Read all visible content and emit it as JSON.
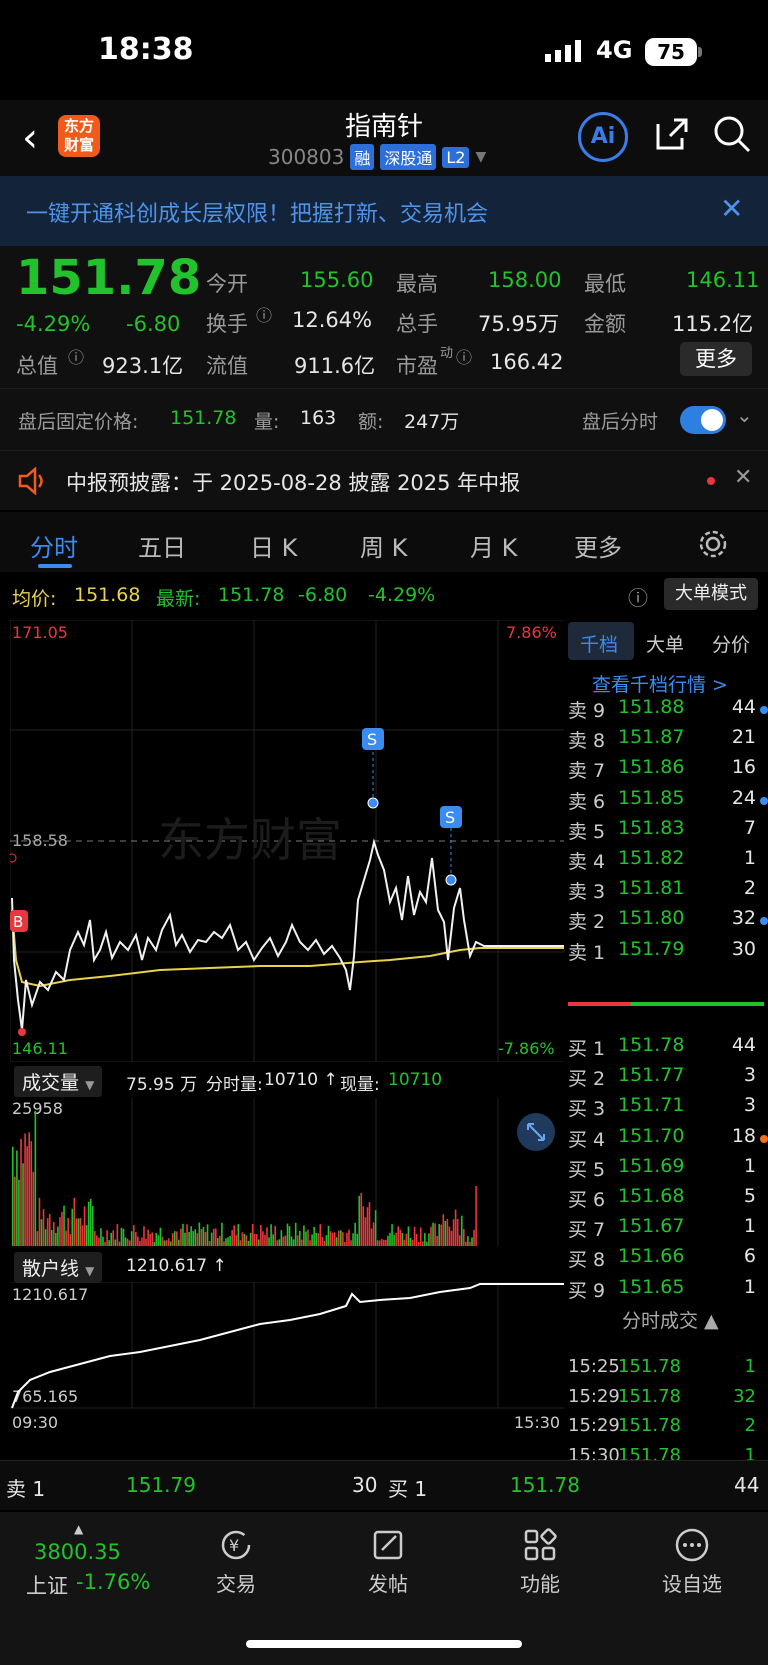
{
  "status": {
    "time": "18:38",
    "network": "4G",
    "battery": "75"
  },
  "nav": {
    "logo": "东方\n财富",
    "title": "指南针",
    "code": "300803",
    "tags": [
      "融",
      "深股通",
      "L2"
    ],
    "ai": "Ai"
  },
  "banner": {
    "text": "一键开通科创成长层权限！把握打新、交易机会"
  },
  "quote": {
    "price": "151.78",
    "chg_pct": "-4.29%",
    "chg": "-6.80",
    "open_label": "今开",
    "open": "155.60",
    "high_label": "最高",
    "high": "158.00",
    "low_label": "最低",
    "low": "146.11",
    "turnover_label": "换手",
    "turnover": "12.64%",
    "vol_label": "总手",
    "vol": "75.95万",
    "amt_label": "金额",
    "amt": "115.2亿",
    "mcap_label": "总值",
    "mcap": "923.1亿",
    "float_label": "流值",
    "float": "911.6亿",
    "pe_label": "市盈",
    "pe_sup": "动",
    "pe": "166.42",
    "more": "更多"
  },
  "after": {
    "label": "盘后固定价格:",
    "price": "151.78",
    "vol_label": "量:",
    "vol": "163",
    "amt_label": "额:",
    "amt": "247万",
    "timeshare": "盘后分时"
  },
  "notice": {
    "text": "中报预披露：于 2025-08-28 披露 2025 年中报"
  },
  "tabs": [
    "分时",
    "五日",
    "日 K",
    "周 K",
    "月 K",
    "更多"
  ],
  "info": {
    "avg_label": "均价:",
    "avg": "151.68",
    "last_label": "最新:",
    "last": "151.78",
    "chg": "-6.80",
    "pct": "-4.29%",
    "mode": "大单模式"
  },
  "chart": {
    "top": "171.05",
    "top_pct": "7.86%",
    "prev": "158.58",
    "bottom": "146.11",
    "bottom_pct": "-7.86%",
    "watermark": "东方财富",
    "marker_s": "S",
    "marker_b": "B"
  },
  "volume": {
    "label": "成交量",
    "total": "75.95 万",
    "minute_label": "分时量:",
    "minute": "10710 ↑",
    "now_label": "现量:",
    "now": "10710",
    "max": "25958"
  },
  "retail": {
    "label": "散户线",
    "value": "1210.617 ↑",
    "top": "1210.617",
    "bottom": "765.165",
    "start": "09:30",
    "end": "15:30"
  },
  "orderbook": {
    "tabs": [
      "千档",
      "大单",
      "分价"
    ],
    "link": "查看千档行情 >",
    "asks": [
      [
        "卖 9",
        "151.88",
        "44"
      ],
      [
        "卖 8",
        "151.87",
        "21"
      ],
      [
        "卖 7",
        "151.86",
        "16"
      ],
      [
        "卖 6",
        "151.85",
        "24"
      ],
      [
        "卖 5",
        "151.83",
        "7"
      ],
      [
        "卖 4",
        "151.82",
        "1"
      ],
      [
        "卖 3",
        "151.81",
        "2"
      ],
      [
        "卖 2",
        "151.80",
        "32"
      ],
      [
        "卖 1",
        "151.79",
        "30"
      ]
    ],
    "bids": [
      [
        "买 1",
        "151.78",
        "44"
      ],
      [
        "买 2",
        "151.77",
        "3"
      ],
      [
        "买 3",
        "151.71",
        "3"
      ],
      [
        "买 4",
        "151.70",
        "18"
      ],
      [
        "买 5",
        "151.69",
        "1"
      ],
      [
        "买 6",
        "151.68",
        "5"
      ],
      [
        "买 7",
        "151.67",
        "1"
      ],
      [
        "买 8",
        "151.66",
        "6"
      ],
      [
        "买 9",
        "151.65",
        "1"
      ]
    ],
    "trades_title": "分时成交 ▲",
    "trades": [
      [
        "15:25",
        "151.78",
        "1"
      ],
      [
        "15:29",
        "151.78",
        "32"
      ],
      [
        "15:29",
        "151.78",
        "2"
      ],
      [
        "15:30",
        "151.78",
        "1"
      ]
    ]
  },
  "bottom": {
    "sell_label": "卖 1",
    "sell_price": "151.79",
    "sell_vol": "30",
    "buy_label": "买 1",
    "buy_price": "151.78",
    "buy_vol": "44"
  },
  "tabbar": {
    "index_value": "3800.35",
    "index_name": "上证",
    "index_pct": "-1.76%",
    "items": [
      "交易",
      "发帖",
      "功能",
      "设自选"
    ]
  },
  "colors": {
    "up": "#e9373d",
    "down": "#22c22c",
    "avg": "#e8d34a",
    "accent": "#3a8cf0"
  }
}
